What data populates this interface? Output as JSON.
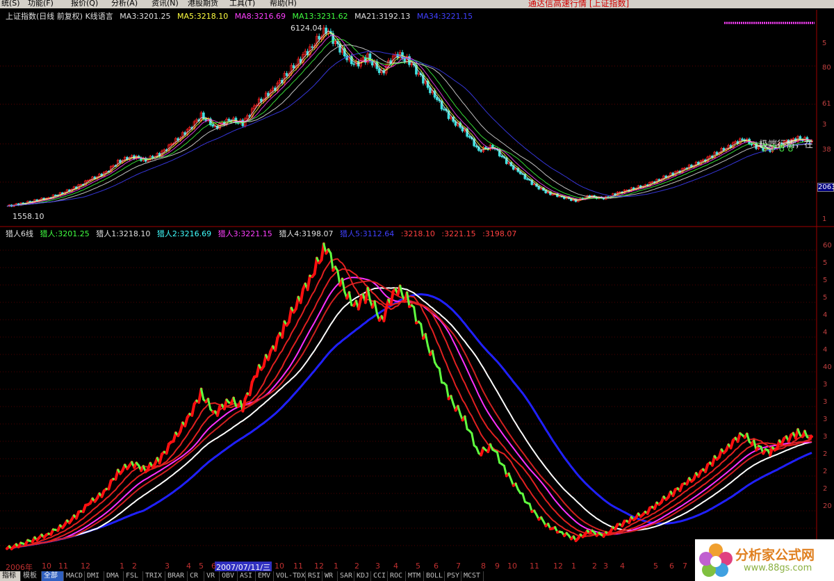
{
  "menu": {
    "items": [
      "统(S)",
      "功能(F)",
      "报价(Q)",
      "分析(A)",
      "资讯(N)",
      "港股期货",
      "工具(T)",
      "帮助(H)"
    ],
    "center_title": "通达信高速行情 [上证指数]"
  },
  "top_panel": {
    "title": "上证指数(日线 前复权) K线语言",
    "ma_labels": [
      {
        "text": "MA3:3201.25",
        "color": "#e0e0e0"
      },
      {
        "text": "MA5:3218.10",
        "color": "#ffff40"
      },
      {
        "text": "MA8:3216.69",
        "color": "#ff40ff"
      },
      {
        "text": "MA13:3231.62",
        "color": "#40ff40"
      },
      {
        "text": "MA21:3192.13",
        "color": "#e0e0e0"
      },
      {
        "text": "MA34:3221.15",
        "color": "#4040ff"
      }
    ],
    "high_label": "6124.04",
    "low_label": "1558.10",
    "right_axis": [
      "5",
      "80",
      "61",
      "3",
      "38",
      "2063",
      "1"
    ],
    "annotation_white": "极端行情，在",
    "annotation_green": "5 7 8 8"
  },
  "bottom_panel": {
    "title": "猎人6线",
    "labels": [
      {
        "text": "猎人:3201.25",
        "color": "#40ff40"
      },
      {
        "text": "猎人1:3218.10",
        "color": "#e0e0e0"
      },
      {
        "text": "猎人2:3216.69",
        "color": "#40ffff"
      },
      {
        "text": "猎人3:3221.15",
        "color": "#ff40ff"
      },
      {
        "text": "猎人4:3198.07",
        "color": "#e0e0e0"
      },
      {
        "text": "猎人5:3112.64",
        "color": "#4040ff"
      },
      {
        "text": ":3218.10",
        "color": "#ff4040"
      },
      {
        "text": ":3221.15",
        "color": "#ff4040"
      },
      {
        "text": ":3198.07",
        "color": "#ff4040"
      }
    ],
    "right_axis": [
      "60",
      "5",
      "5",
      "5",
      "4",
      "4",
      "4",
      "40",
      "3",
      "3",
      "3",
      "3",
      "2",
      "2",
      "2",
      "20"
    ]
  },
  "datebar": {
    "labels": [
      "2006年",
      "10",
      "11",
      "12",
      "1",
      "2",
      "3",
      "4",
      "5",
      "6",
      "7",
      "10",
      "11",
      "12",
      "1",
      "2",
      "3",
      "4",
      "5",
      "6",
      "7",
      "8",
      "9",
      "10",
      "11",
      "12",
      "1",
      "2",
      "3",
      "4",
      "5",
      "6",
      "7"
    ],
    "cursor": "2007/07/11/三"
  },
  "tabs": [
    "指标",
    "模板",
    "全部",
    "MACD",
    "DMI",
    "DMA",
    "FSL",
    "TRIX",
    "BRAR",
    "CR",
    "VR",
    "OBV",
    "ASI",
    "EMV",
    "VOL-TDX",
    "RSI",
    "WR",
    "SAR",
    "KDJ",
    "CCI",
    "ROC",
    "MTM",
    "BOLL",
    "PSY",
    "MCST"
  ],
  "watermark": {
    "site": "分析家公式网",
    "url": "www.88gs.com"
  },
  "colors": {
    "up": "#ff2020",
    "down": "#40ff40",
    "ma_blue": "#2020ff",
    "ma_white": "#ffffff",
    "ma_magenta": "#ff30ff",
    "grid": "#800000"
  },
  "price_series": [
    1558,
    1620,
    1700,
    1780,
    1900,
    2050,
    2250,
    2400,
    2700,
    2850,
    2750,
    2900,
    3200,
    3500,
    3900,
    3600,
    3800,
    3700,
    4200,
    4500,
    4900,
    5300,
    5700,
    6124,
    5600,
    5200,
    5400,
    5000,
    5500,
    5300,
    4800,
    4300,
    3800,
    3500,
    3000,
    3100,
    2700,
    2400,
    2100,
    1900,
    1800,
    1700,
    1820,
    1750,
    1900,
    2000,
    2100,
    2250,
    2400,
    2550,
    2700,
    2900,
    3100,
    3300,
    3100,
    3000,
    3200,
    3300,
    3250
  ]
}
